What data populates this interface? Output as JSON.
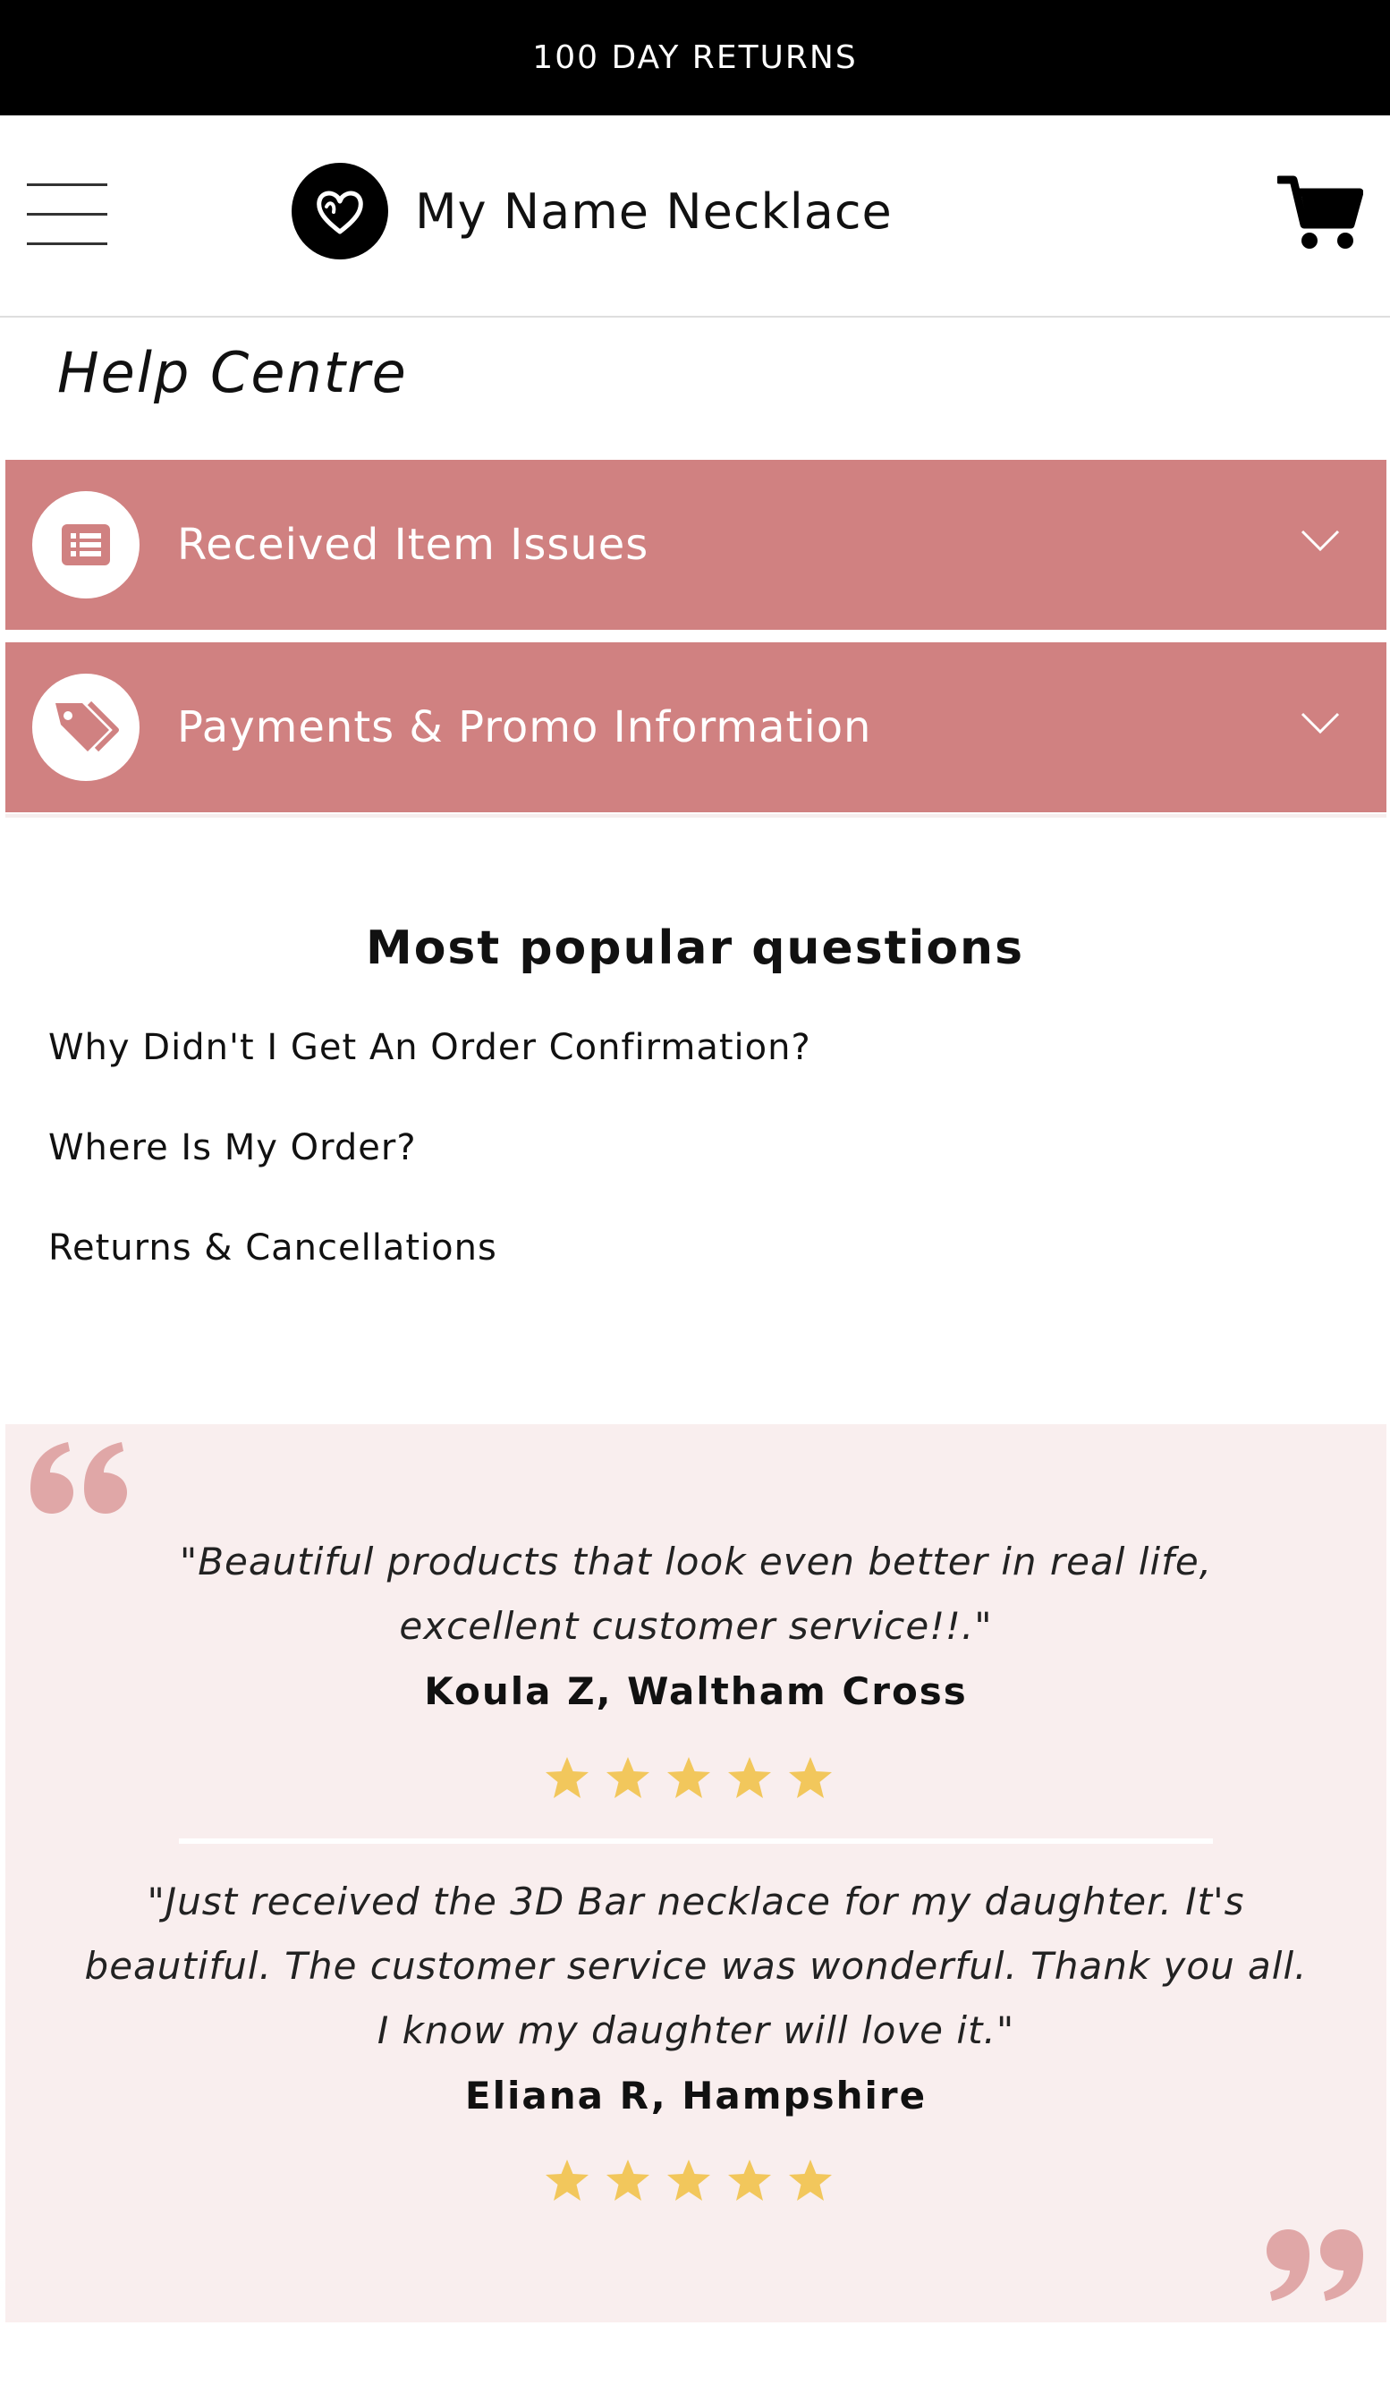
{
  "announcement": "100 DAY RETURNS",
  "header": {
    "brand_name": "My Name Necklace",
    "menu_icon": "hamburger-menu-icon",
    "cart_icon": "shopping-cart-icon",
    "logo_icon": "heart-logo-icon"
  },
  "help": {
    "title": "Help Centre"
  },
  "accordions": [
    {
      "label": "Received Item Issues",
      "icon": "list-icon"
    },
    {
      "label": "Payments & Promo Information",
      "icon": "tags-icon"
    }
  ],
  "popular": {
    "title": "Most popular questions",
    "questions": [
      "Why Didn't I Get An Order Confirmation?",
      "Where Is My Order?",
      "Returns & Cancellations"
    ]
  },
  "testimonials": [
    {
      "lines": [
        "\"Beautiful products that look even better in real life,",
        "excellent customer service!!.\""
      ],
      "author": "Koula Z, Waltham Cross",
      "rating": 5
    },
    {
      "lines": [
        "\"Just received the 3D Bar necklace for my daughter. It's",
        "beautiful. The customer service was wonderful. Thank you all.",
        "I know my daughter will love it.\""
      ],
      "author": "Eliana R, Hampshire",
      "rating": 5
    }
  ],
  "colors": {
    "accordion_bg": "#d08181",
    "testimonial_bg": "#f9eeee",
    "quote_mark": "#e0a7a7",
    "star": "#f2c75c"
  }
}
